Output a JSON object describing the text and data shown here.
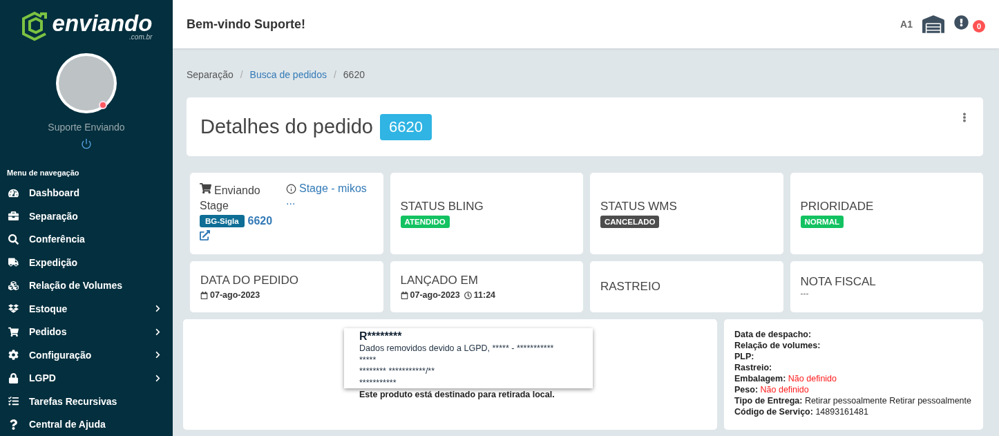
{
  "brand": {
    "name": "enviando",
    "domain": ".com.br"
  },
  "user": {
    "name": "Suporte Enviando",
    "online": false
  },
  "nav": {
    "heading": "Menu de navegação",
    "items": [
      {
        "label": "Dashboard",
        "expandable": false
      },
      {
        "label": "Separação",
        "expandable": false
      },
      {
        "label": "Conferência",
        "expandable": false
      },
      {
        "label": "Expedição",
        "expandable": false
      },
      {
        "label": "Relação de Volumes",
        "expandable": false
      },
      {
        "label": "Estoque",
        "expandable": true
      },
      {
        "label": "Pedidos",
        "expandable": true
      },
      {
        "label": "Configuração",
        "expandable": true
      },
      {
        "label": "LGPD",
        "expandable": true
      },
      {
        "label": "Tarefas Recursivas",
        "expandable": false
      },
      {
        "label": "Central de Ajuda",
        "expandable": false
      }
    ]
  },
  "header": {
    "greeting": "Bem-vindo Suporte!",
    "warehouse": "A1",
    "alerts": "0"
  },
  "breadcrumb_separator": "/",
  "breadcrumb": [
    {
      "label": "Separação",
      "link": false
    },
    {
      "label": "Busca de pedidos",
      "link": true
    },
    {
      "label": "6620",
      "link": false
    }
  ],
  "page": {
    "title": "Detalhes do pedido",
    "order": "6620"
  },
  "store_card": {
    "store": "Enviando Stage",
    "integration": "Stage - mikos",
    "more": "...",
    "tag": "BG-Sigla",
    "order": "6620"
  },
  "status_cards": [
    {
      "label": "STATUS BLING",
      "badge": "ATENDIDO",
      "color": "#13c261"
    },
    {
      "label": "STATUS WMS",
      "badge": "CANCELADO",
      "color": "#4d4d4d"
    },
    {
      "label": "PRIORIDADE",
      "badge": "NORMAL",
      "color": "#13c261"
    }
  ],
  "date_cards": [
    {
      "label": "DATA DO PEDIDO",
      "kind": "date",
      "date": "07-ago-2023"
    },
    {
      "label": "LANÇADO EM",
      "kind": "datetime",
      "date": "07-ago-2023",
      "time": "11:24"
    },
    {
      "label": "RASTREIO",
      "kind": "empty"
    },
    {
      "label": "NOTA FISCAL",
      "kind": "text",
      "value": "---"
    }
  ],
  "customer": {
    "name": "R********",
    "lines": [
      "Dados removidos devido a LGPD, ***** - ***********",
      "*****",
      "******** ***********/**",
      "***********"
    ],
    "note": "Este produto está destinado para retirada local."
  },
  "shipping": [
    {
      "label": "Data de despacho:"
    },
    {
      "label": "Relação de volumes:"
    },
    {
      "label": "PLP:"
    },
    {
      "label": "Rastreio:"
    },
    {
      "label": "Embalagem:",
      "value": "Não definido",
      "missing": true
    },
    {
      "label": "Peso:",
      "value": "Não definido",
      "missing": true
    },
    {
      "label": "Tipo de Entrega:",
      "value": "Retirar pessoalmente Retirar pessoalmente",
      "missing": false
    },
    {
      "label": "Código de Serviço:",
      "value": "14893161481",
      "missing": false
    }
  ]
}
